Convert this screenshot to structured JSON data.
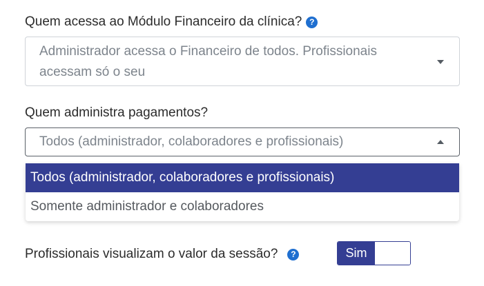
{
  "finance_access": {
    "label": "Quem acessa ao Módulo Financeiro da clínica?",
    "help_icon": "?",
    "selected_value": "Administrador acessa o Financeiro de todos. Profissionais acessam só o seu"
  },
  "payments_admin": {
    "label": "Quem administra pagamentos?",
    "selected_value": "Todos (administrador, colaboradores e profissionais)",
    "options": [
      "Todos (administrador, colaboradores e profissionais)",
      "Somente administrador e colaboradores"
    ]
  },
  "session_value": {
    "label": "Profissionais visualizam o valor da sessão?",
    "help_icon": "?",
    "toggle_label": "Sim"
  },
  "colors": {
    "accent": "#343e93",
    "help_icon": "#1f6fd0",
    "border": "#cfd3d8"
  }
}
